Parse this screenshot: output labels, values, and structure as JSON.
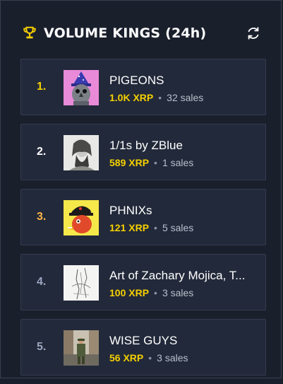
{
  "header": {
    "title": "VOLUME KINGS (24h)"
  },
  "colors": {
    "rank_gold": "#f5d000",
    "rank_white": "#ffffff",
    "rank_bronze": "#ffb347",
    "rank_gray": "#9aa7c0",
    "volume": "#f5d000"
  },
  "items": [
    {
      "rank": "1.",
      "name": "PIGEONS",
      "volume": "1.0K XRP",
      "sales": "32 sales"
    },
    {
      "rank": "2.",
      "name": "1/1s by ZBlue",
      "volume": "589 XRP",
      "sales": "1 sales"
    },
    {
      "rank": "3.",
      "name": "PHNIXs",
      "volume": "121 XRP",
      "sales": "5 sales"
    },
    {
      "rank": "4.",
      "name": "Art of Zachary Mojica, T...",
      "volume": "100 XRP",
      "sales": "3 sales"
    },
    {
      "rank": "5.",
      "name": "WISE GUYS",
      "volume": "56 XRP",
      "sales": "3 sales"
    }
  ]
}
